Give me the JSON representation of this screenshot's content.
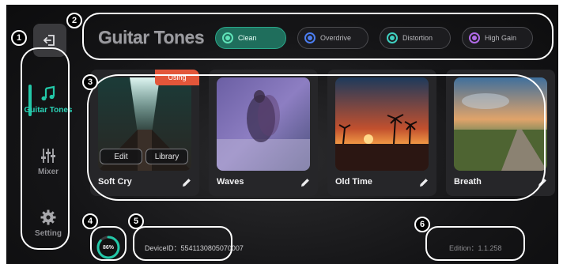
{
  "header": {
    "title": "Guitar Tones"
  },
  "tones": [
    {
      "label": "Clean",
      "active": true,
      "dot_color": "#5fe3b8"
    },
    {
      "label": "Overdrive",
      "active": false,
      "dot_color": "#4b7df0"
    },
    {
      "label": "Distortion",
      "active": false,
      "dot_color": "#3fd0c0"
    },
    {
      "label": "High Gain",
      "active": false,
      "dot_color": "#b26be8"
    }
  ],
  "sidebar": {
    "items": [
      {
        "label": "Guitar Tones",
        "icon": "music-note-icon",
        "active": true
      },
      {
        "label": "Mixer",
        "icon": "sliders-icon",
        "active": false
      },
      {
        "label": "Setting",
        "icon": "gear-icon",
        "active": false
      }
    ]
  },
  "cards": [
    {
      "name": "Soft Cry",
      "badge": "Using",
      "actions": [
        "Edit",
        "Library"
      ]
    },
    {
      "name": "Waves"
    },
    {
      "name": "Old Time"
    },
    {
      "name": "Breath"
    }
  ],
  "footer": {
    "progress_label": "86%",
    "progress_value": 0.86,
    "device_id": "DeviceID：5541130805070007",
    "edition": "Edition：1.1.258"
  },
  "annotations": [
    "1",
    "2",
    "3",
    "4",
    "5",
    "6"
  ],
  "colors": {
    "accent": "#23c8a8",
    "badge": "#e2563a",
    "annotation": "#ffffff"
  }
}
